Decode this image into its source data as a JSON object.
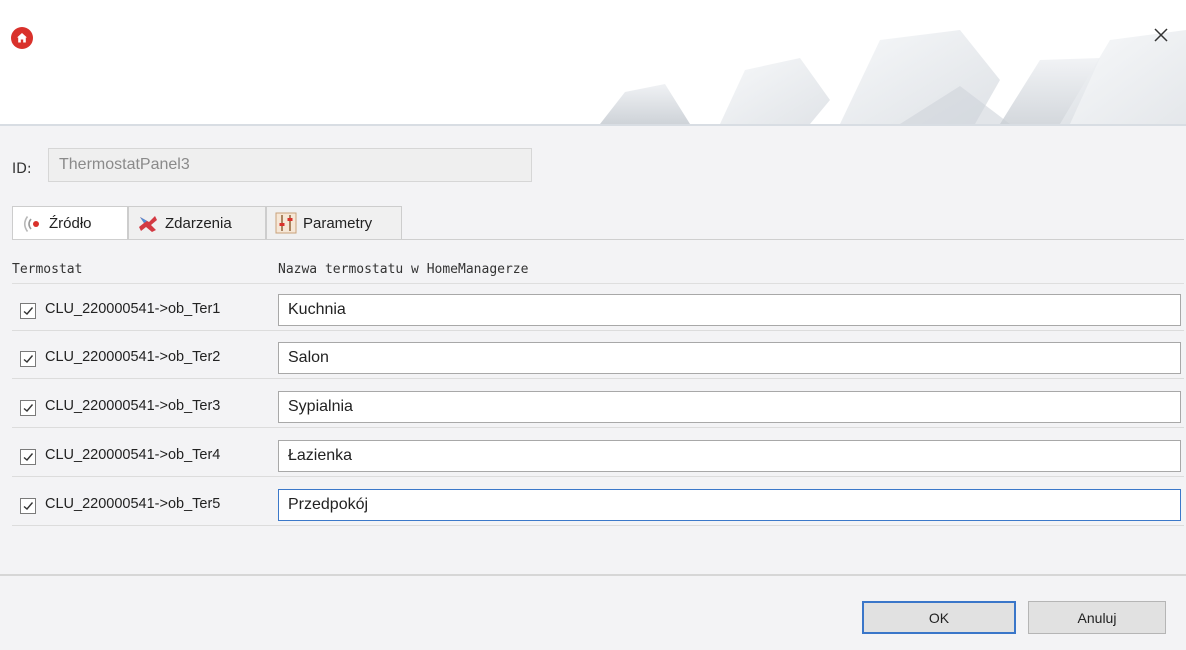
{
  "window": {
    "close_glyph": "×",
    "icons": {
      "logo": "home-logo-icon",
      "close": "close-icon"
    }
  },
  "id_row": {
    "label": "ID:",
    "value": "ThermostatPanel3"
  },
  "tabs": [
    {
      "label": "Źródło",
      "icon": "source-icon",
      "active": true
    },
    {
      "label": "Zdarzenia",
      "icon": "events-icon",
      "active": false
    },
    {
      "label": "Parametry",
      "icon": "parameters-icon",
      "active": false
    }
  ],
  "table": {
    "headers": [
      "Termostat",
      "Nazwa termostatu w HomeManagerze"
    ],
    "rows": [
      {
        "checked": true,
        "thermostat": "CLU_220000541->ob_Ter1",
        "name": "Kuchnia"
      },
      {
        "checked": true,
        "thermostat": "CLU_220000541->ob_Ter2",
        "name": "Salon"
      },
      {
        "checked": true,
        "thermostat": "CLU_220000541->ob_Ter3",
        "name": "Sypialnia"
      },
      {
        "checked": true,
        "thermostat": "CLU_220000541->ob_Ter4",
        "name": "Łazienka"
      },
      {
        "checked": true,
        "thermostat": "CLU_220000541->ob_Ter5",
        "name": "Przedpokój"
      }
    ]
  },
  "buttons": {
    "ok": "OK",
    "cancel": "Anuluj"
  },
  "colors": {
    "accent": "#3a76c9",
    "logo": "#d9312b",
    "body_bg": "#f3f3f5"
  }
}
